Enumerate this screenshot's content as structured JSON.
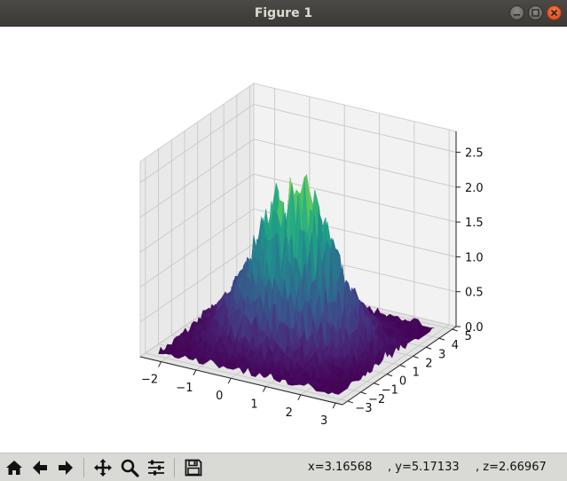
{
  "window": {
    "title": "Figure 1"
  },
  "toolbar": {
    "buttons": [
      {
        "icon": "home-icon"
      },
      {
        "icon": "back-arrow-icon"
      },
      {
        "icon": "forward-arrow-icon"
      },
      {
        "icon": "pan-icon"
      },
      {
        "icon": "zoom-icon"
      },
      {
        "icon": "configure-subplots-icon"
      },
      {
        "icon": "save-icon"
      }
    ],
    "coord_x": "x=3.16568",
    "coord_y": ", y=5.17133",
    "coord_z": ", z=2.66967"
  },
  "chart_data": {
    "type": "surface",
    "title": "",
    "xlabel": "",
    "ylabel": "",
    "zlabel": "",
    "x_ticks": [
      "−2",
      "−1",
      "0",
      "1",
      "2",
      "3"
    ],
    "y_ticks": [
      "−3",
      "−2",
      "−1",
      "0",
      "1",
      "2",
      "3",
      "4",
      "5"
    ],
    "z_ticks": [
      "0.0",
      "0.5",
      "1.0",
      "1.5",
      "2.0",
      "2.5"
    ],
    "xlim": [
      -2.6,
      3.2
    ],
    "ylim": [
      -3.4,
      5.3
    ],
    "zlim": [
      0,
      2.8
    ],
    "colormap": "viridis",
    "peak_value": 2.7,
    "grid": true,
    "pane_color": "#f2f2f2"
  }
}
